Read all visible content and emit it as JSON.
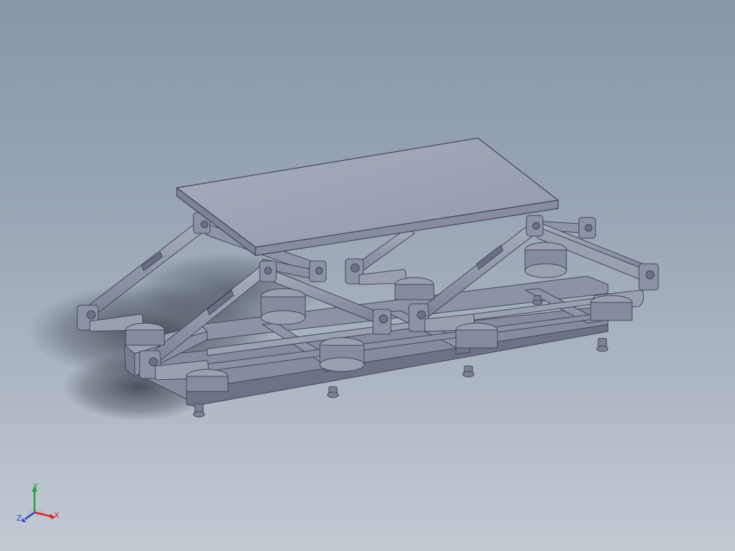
{
  "viewport": {
    "background_top": "#8797aa",
    "background_bottom": "#c3cad2",
    "part_color": "#8e95a8",
    "part_dark": "#5d6376",
    "part_light": "#aab0c2"
  },
  "model": {
    "components": [
      "top-plate",
      "base-frame",
      "scissor-links",
      "pivot-joints",
      "leveling-feet"
    ]
  },
  "triad": {
    "x_label": "X",
    "y_label": "Y",
    "z_label": "Z",
    "x_color": "#d8202a",
    "y_color": "#1ea23a",
    "z_color": "#2740c8"
  }
}
